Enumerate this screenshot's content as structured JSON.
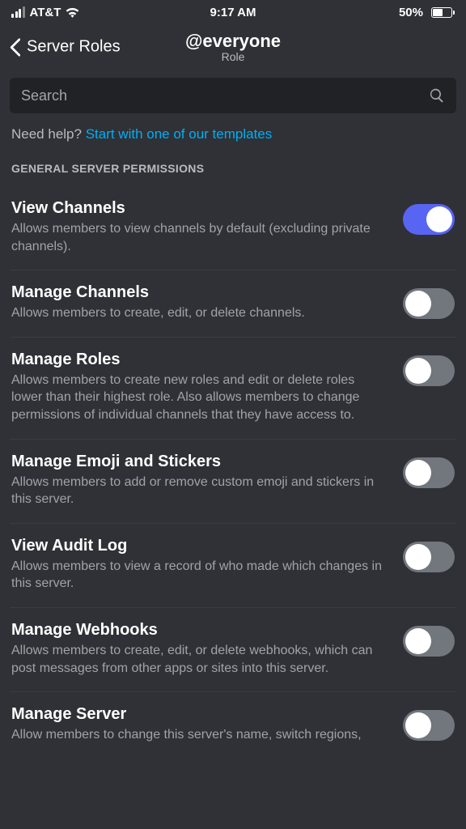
{
  "status": {
    "carrier": "AT&T",
    "time": "9:17 AM",
    "battery_pct": "50%"
  },
  "nav": {
    "back_label": "Server Roles",
    "title": "@everyone",
    "subtitle": "Role"
  },
  "search": {
    "placeholder": "Search"
  },
  "help": {
    "prefix": "Need help? ",
    "link": "Start with one of our templates"
  },
  "section_header": "GENERAL SERVER PERMISSIONS",
  "permissions": [
    {
      "key": "view-channels",
      "title": "View Channels",
      "desc": "Allows members to view channels by default (excluding private channels).",
      "on": true
    },
    {
      "key": "manage-channels",
      "title": "Manage Channels",
      "desc": "Allows members to create, edit, or delete channels.",
      "on": false
    },
    {
      "key": "manage-roles",
      "title": "Manage Roles",
      "desc": "Allows members to create new roles and edit or delete roles lower than their highest role. Also allows members to change permissions of individual channels that they have access to.",
      "on": false
    },
    {
      "key": "manage-emoji",
      "title": "Manage Emoji and Stickers",
      "desc": "Allows members to add or remove custom emoji and stickers in this server.",
      "on": false
    },
    {
      "key": "view-audit-log",
      "title": "View Audit Log",
      "desc": "Allows members to view a record of who made which changes in this server.",
      "on": false
    },
    {
      "key": "manage-webhooks",
      "title": "Manage Webhooks",
      "desc": "Allows members to create, edit, or delete webhooks, which can post messages from other apps or sites into this server.",
      "on": false
    },
    {
      "key": "manage-server",
      "title": "Manage Server",
      "desc": "Allow members to change this server's name, switch regions,",
      "on": false
    }
  ]
}
